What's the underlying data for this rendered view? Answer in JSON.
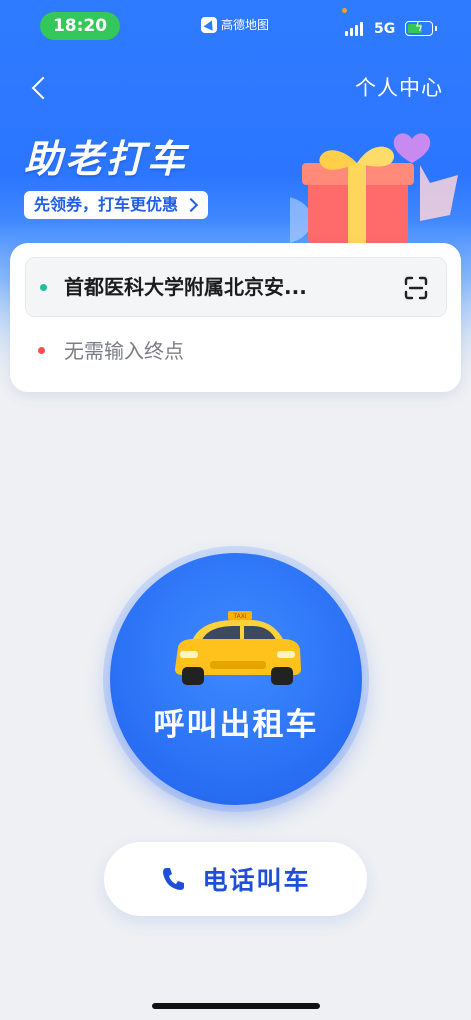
{
  "status_bar": {
    "time": "18:20",
    "app_name": "高德地图",
    "network": "5G"
  },
  "nav": {
    "personal_center": "个人中心"
  },
  "hero": {
    "title": "助老打车",
    "coupon": "先领券，打车更优惠"
  },
  "route": {
    "origin": "首都医科大学附属北京安...",
    "destination_placeholder": "无需输入终点"
  },
  "actions": {
    "call_taxi": "呼叫出租车",
    "phone_call": "电话叫车",
    "taxi_sign": "TAXI"
  },
  "colors": {
    "brand_blue": "#2f7bff",
    "origin_dot": "#19c29a",
    "destination_dot": "#ff4d4f",
    "taxi_yellow": "#ffc21c"
  }
}
